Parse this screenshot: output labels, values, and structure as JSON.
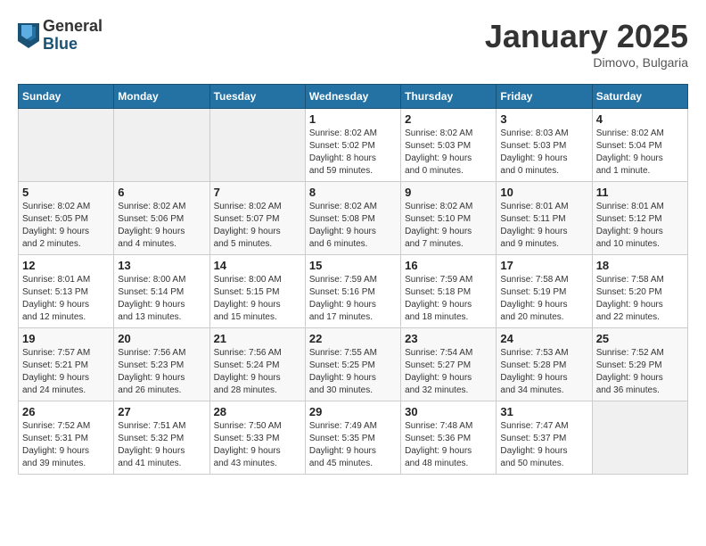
{
  "header": {
    "logo_general": "General",
    "logo_blue": "Blue",
    "month_title": "January 2025",
    "location": "Dimovo, Bulgaria"
  },
  "calendar": {
    "days_of_week": [
      "Sunday",
      "Monday",
      "Tuesday",
      "Wednesday",
      "Thursday",
      "Friday",
      "Saturday"
    ],
    "weeks": [
      [
        {
          "day": "",
          "info": ""
        },
        {
          "day": "",
          "info": ""
        },
        {
          "day": "",
          "info": ""
        },
        {
          "day": "1",
          "info": "Sunrise: 8:02 AM\nSunset: 5:02 PM\nDaylight: 8 hours\nand 59 minutes."
        },
        {
          "day": "2",
          "info": "Sunrise: 8:02 AM\nSunset: 5:03 PM\nDaylight: 9 hours\nand 0 minutes."
        },
        {
          "day": "3",
          "info": "Sunrise: 8:03 AM\nSunset: 5:03 PM\nDaylight: 9 hours\nand 0 minutes."
        },
        {
          "day": "4",
          "info": "Sunrise: 8:02 AM\nSunset: 5:04 PM\nDaylight: 9 hours\nand 1 minute."
        }
      ],
      [
        {
          "day": "5",
          "info": "Sunrise: 8:02 AM\nSunset: 5:05 PM\nDaylight: 9 hours\nand 2 minutes."
        },
        {
          "day": "6",
          "info": "Sunrise: 8:02 AM\nSunset: 5:06 PM\nDaylight: 9 hours\nand 4 minutes."
        },
        {
          "day": "7",
          "info": "Sunrise: 8:02 AM\nSunset: 5:07 PM\nDaylight: 9 hours\nand 5 minutes."
        },
        {
          "day": "8",
          "info": "Sunrise: 8:02 AM\nSunset: 5:08 PM\nDaylight: 9 hours\nand 6 minutes."
        },
        {
          "day": "9",
          "info": "Sunrise: 8:02 AM\nSunset: 5:10 PM\nDaylight: 9 hours\nand 7 minutes."
        },
        {
          "day": "10",
          "info": "Sunrise: 8:01 AM\nSunset: 5:11 PM\nDaylight: 9 hours\nand 9 minutes."
        },
        {
          "day": "11",
          "info": "Sunrise: 8:01 AM\nSunset: 5:12 PM\nDaylight: 9 hours\nand 10 minutes."
        }
      ],
      [
        {
          "day": "12",
          "info": "Sunrise: 8:01 AM\nSunset: 5:13 PM\nDaylight: 9 hours\nand 12 minutes."
        },
        {
          "day": "13",
          "info": "Sunrise: 8:00 AM\nSunset: 5:14 PM\nDaylight: 9 hours\nand 13 minutes."
        },
        {
          "day": "14",
          "info": "Sunrise: 8:00 AM\nSunset: 5:15 PM\nDaylight: 9 hours\nand 15 minutes."
        },
        {
          "day": "15",
          "info": "Sunrise: 7:59 AM\nSunset: 5:16 PM\nDaylight: 9 hours\nand 17 minutes."
        },
        {
          "day": "16",
          "info": "Sunrise: 7:59 AM\nSunset: 5:18 PM\nDaylight: 9 hours\nand 18 minutes."
        },
        {
          "day": "17",
          "info": "Sunrise: 7:58 AM\nSunset: 5:19 PM\nDaylight: 9 hours\nand 20 minutes."
        },
        {
          "day": "18",
          "info": "Sunrise: 7:58 AM\nSunset: 5:20 PM\nDaylight: 9 hours\nand 22 minutes."
        }
      ],
      [
        {
          "day": "19",
          "info": "Sunrise: 7:57 AM\nSunset: 5:21 PM\nDaylight: 9 hours\nand 24 minutes."
        },
        {
          "day": "20",
          "info": "Sunrise: 7:56 AM\nSunset: 5:23 PM\nDaylight: 9 hours\nand 26 minutes."
        },
        {
          "day": "21",
          "info": "Sunrise: 7:56 AM\nSunset: 5:24 PM\nDaylight: 9 hours\nand 28 minutes."
        },
        {
          "day": "22",
          "info": "Sunrise: 7:55 AM\nSunset: 5:25 PM\nDaylight: 9 hours\nand 30 minutes."
        },
        {
          "day": "23",
          "info": "Sunrise: 7:54 AM\nSunset: 5:27 PM\nDaylight: 9 hours\nand 32 minutes."
        },
        {
          "day": "24",
          "info": "Sunrise: 7:53 AM\nSunset: 5:28 PM\nDaylight: 9 hours\nand 34 minutes."
        },
        {
          "day": "25",
          "info": "Sunrise: 7:52 AM\nSunset: 5:29 PM\nDaylight: 9 hours\nand 36 minutes."
        }
      ],
      [
        {
          "day": "26",
          "info": "Sunrise: 7:52 AM\nSunset: 5:31 PM\nDaylight: 9 hours\nand 39 minutes."
        },
        {
          "day": "27",
          "info": "Sunrise: 7:51 AM\nSunset: 5:32 PM\nDaylight: 9 hours\nand 41 minutes."
        },
        {
          "day": "28",
          "info": "Sunrise: 7:50 AM\nSunset: 5:33 PM\nDaylight: 9 hours\nand 43 minutes."
        },
        {
          "day": "29",
          "info": "Sunrise: 7:49 AM\nSunset: 5:35 PM\nDaylight: 9 hours\nand 45 minutes."
        },
        {
          "day": "30",
          "info": "Sunrise: 7:48 AM\nSunset: 5:36 PM\nDaylight: 9 hours\nand 48 minutes."
        },
        {
          "day": "31",
          "info": "Sunrise: 7:47 AM\nSunset: 5:37 PM\nDaylight: 9 hours\nand 50 minutes."
        },
        {
          "day": "",
          "info": ""
        }
      ]
    ]
  }
}
